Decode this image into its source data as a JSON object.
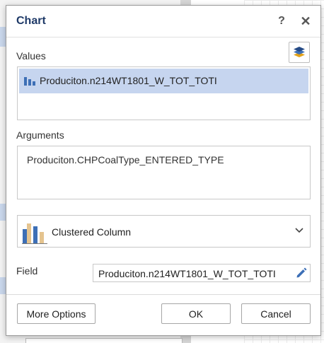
{
  "dialog": {
    "title": "Chart",
    "help_label": "?",
    "close_label": "✕"
  },
  "values": {
    "label": "Values",
    "items": [
      {
        "label": "Produciton.n214WT1801_W_TOT_TOTI"
      }
    ]
  },
  "arguments": {
    "label": "Arguments",
    "items": [
      {
        "label": "Produciton.CHPCoalType_ENTERED_TYPE"
      }
    ]
  },
  "chart_type": {
    "selected": "Clustered Column"
  },
  "field": {
    "label": "Field",
    "value": "Produciton.n214WT1801_W_TOT_TOTI"
  },
  "buttons": {
    "more_options": "More Options",
    "ok": "OK",
    "cancel": "Cancel"
  },
  "colors": {
    "title": "#1f3a68",
    "selection": "#c6d5ef",
    "icon_blue": "#3d6fb6",
    "icon_tan": "#e5c48f"
  },
  "icons": [
    "help-icon",
    "close-icon",
    "layers-icon",
    "bar-series-icon",
    "clustered-column-icon",
    "chevron-down-icon",
    "pencil-icon"
  ]
}
